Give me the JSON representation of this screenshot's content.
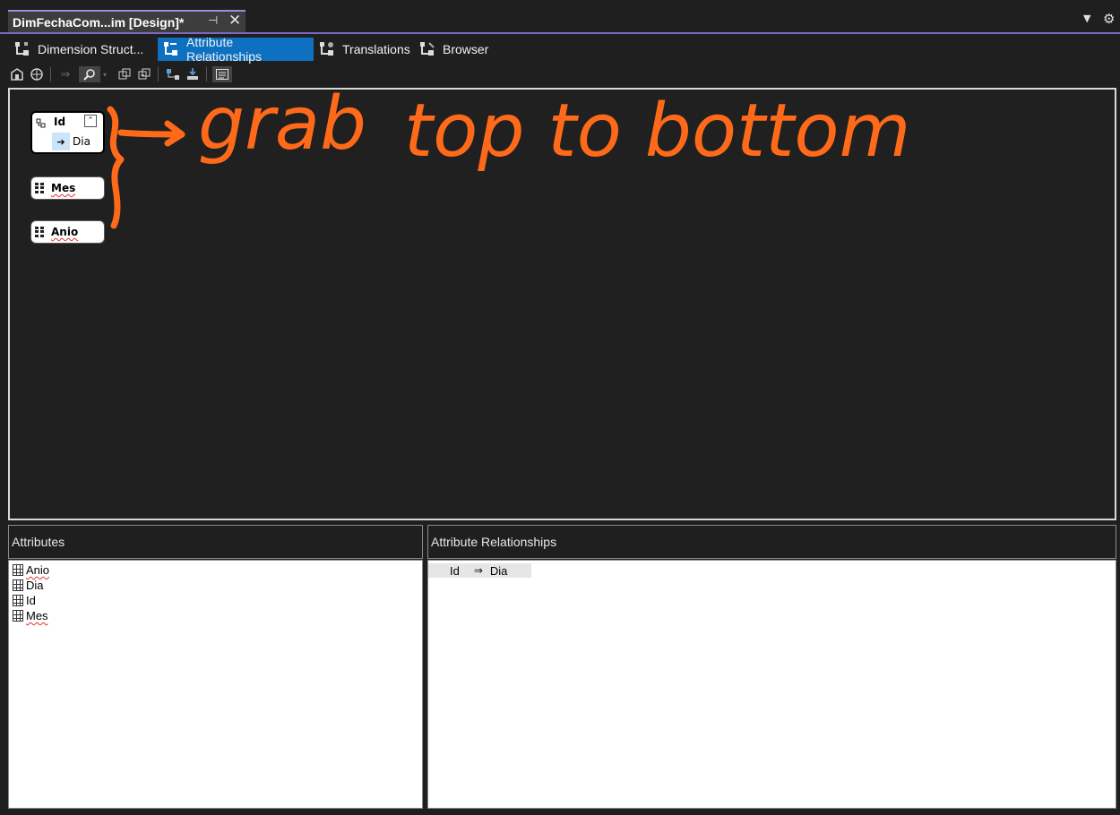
{
  "document_tab": {
    "title": "DimFechaCom...im [Design]*",
    "pin_glyph": "⊣",
    "close_glyph": "✕"
  },
  "window_controls": {
    "dropdown_glyph": "▼",
    "gear_glyph": "⚙"
  },
  "designer_tabs": [
    {
      "label": "Dimension Struct...",
      "icon": "dimension-structure-icon",
      "active": false
    },
    {
      "label": "Attribute Relationships",
      "icon": "attribute-relationships-icon",
      "active": true
    },
    {
      "label": "Translations",
      "icon": "translations-icon",
      "active": false
    },
    {
      "label": "Browser",
      "icon": "browser-icon",
      "active": false
    }
  ],
  "toolbar": {
    "buttons": [
      {
        "icon": "process-icon"
      },
      {
        "icon": "deploy-icon"
      },
      {
        "icon": "new-relationship-icon"
      },
      {
        "icon": "zoom-icon"
      },
      {
        "icon": "zoom-dropdown-icon"
      },
      {
        "icon": "collapse-all-icon"
      },
      {
        "icon": "expand-all-icon"
      },
      {
        "icon": "new-key-icon"
      },
      {
        "icon": "auto-layout-icon"
      },
      {
        "icon": "properties-icon"
      }
    ]
  },
  "diagram": {
    "nodes": [
      {
        "name": "Id",
        "relationships": [
          "Dia"
        ],
        "expanded": true
      },
      {
        "name": "Mes",
        "relationships": []
      },
      {
        "name": "Anio",
        "relationships": []
      }
    ],
    "annotation": {
      "text_1": "grab",
      "text_2": "top to bottom",
      "color": "#ff6a1a"
    }
  },
  "attributes_pane": {
    "header": "Attributes",
    "items": [
      "Anio",
      "Dia",
      "Id",
      "Mes"
    ]
  },
  "relationships_pane": {
    "header": "Attribute Relationships",
    "rows": [
      {
        "from": "Id",
        "arrow": "⇒",
        "to": "Dia"
      }
    ]
  },
  "colors": {
    "accent": "#7b68c8",
    "active_tab": "#0e70c0",
    "background": "#1f1f1f",
    "annotation": "#ff6a1a"
  }
}
